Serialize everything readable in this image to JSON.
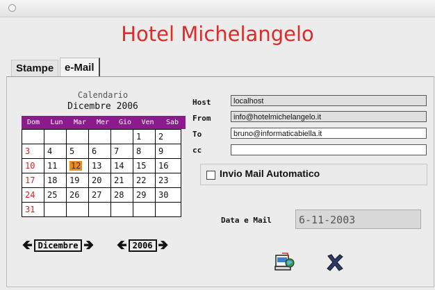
{
  "app": {
    "title": "Hotel Michelangelo"
  },
  "tabs": [
    {
      "label": "Stampe"
    },
    {
      "label": "e-Mail"
    }
  ],
  "calendar": {
    "label": "Calendario",
    "month_year": "Dicembre 2006",
    "weekdays": [
      "Dom",
      "Lun",
      "Mar",
      "Mer",
      "Gio",
      "Ven",
      "Sab"
    ],
    "weeks": [
      [
        "",
        "",
        "",
        "",
        "",
        "1",
        "2"
      ],
      [
        "3",
        "4",
        "5",
        "6",
        "7",
        "8",
        "9"
      ],
      [
        "10",
        "11",
        "12",
        "13",
        "14",
        "15",
        "16"
      ],
      [
        "17",
        "18",
        "19",
        "20",
        "21",
        "22",
        "23"
      ],
      [
        "24",
        "25",
        "26",
        "27",
        "28",
        "29",
        "30"
      ],
      [
        "31",
        "",
        "",
        "",
        "",
        "",
        ""
      ]
    ],
    "selected_day": "12",
    "sunday_color": "#d62020",
    "header_color": "#8b1a8c",
    "highlight_color": "#f08a1a",
    "month_nav": "Dicembre",
    "year_nav": "2006"
  },
  "mail": {
    "host_label": "Host",
    "host_value": "localhost",
    "from_label": "From",
    "from_value": "info@hotelmichelangelo.it",
    "to_label": "To",
    "to_value": "bruno@informaticabiella.it",
    "cc_label": "cc",
    "cc_value": "",
    "auto_label": "Invio Mail Automatico",
    "auto_checked": false
  },
  "date": {
    "label": "Data e Mail",
    "value": "6-11-2003"
  },
  "icons": {
    "send": "send-mail-icon",
    "close": "close-x-icon"
  }
}
